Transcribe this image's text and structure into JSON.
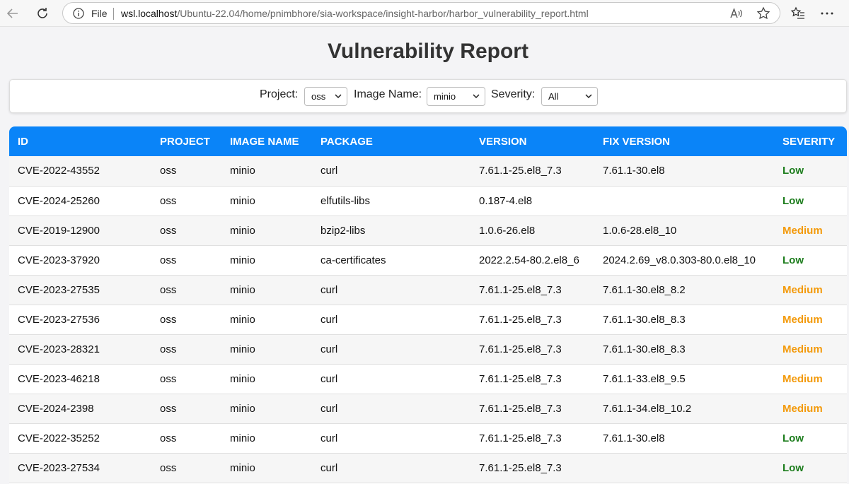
{
  "browser": {
    "file_label": "File",
    "url_host": "wsl.localhost",
    "url_path": "/Ubuntu-22.04/home/pnimbhore/sia-workspace/insight-harbor/harbor_vulnerability_report.html"
  },
  "page": {
    "title": "Vulnerability Report"
  },
  "filters": {
    "project_label": "Project:",
    "project_value": "oss",
    "image_label": "Image Name:",
    "image_value": "minio",
    "severity_label": "Severity:",
    "severity_value": "All"
  },
  "table": {
    "headers": [
      "ID",
      "PROJECT",
      "IMAGE NAME",
      "PACKAGE",
      "VERSION",
      "FIX VERSION",
      "SEVERITY"
    ],
    "rows": [
      [
        "CVE-2022-43552",
        "oss",
        "minio",
        "curl",
        "7.61.1-25.el8_7.3",
        "7.61.1-30.el8",
        "Low"
      ],
      [
        "CVE-2024-25260",
        "oss",
        "minio",
        "elfutils-libs",
        "0.187-4.el8",
        "",
        "Low"
      ],
      [
        "CVE-2019-12900",
        "oss",
        "minio",
        "bzip2-libs",
        "1.0.6-26.el8",
        "1.0.6-28.el8_10",
        "Medium"
      ],
      [
        "CVE-2023-37920",
        "oss",
        "minio",
        "ca-certificates",
        "2022.2.54-80.2.el8_6",
        "2024.2.69_v8.0.303-80.0.el8_10",
        "Low"
      ],
      [
        "CVE-2023-27535",
        "oss",
        "minio",
        "curl",
        "7.61.1-25.el8_7.3",
        "7.61.1-30.el8_8.2",
        "Medium"
      ],
      [
        "CVE-2023-27536",
        "oss",
        "minio",
        "curl",
        "7.61.1-25.el8_7.3",
        "7.61.1-30.el8_8.3",
        "Medium"
      ],
      [
        "CVE-2023-28321",
        "oss",
        "minio",
        "curl",
        "7.61.1-25.el8_7.3",
        "7.61.1-30.el8_8.3",
        "Medium"
      ],
      [
        "CVE-2023-46218",
        "oss",
        "minio",
        "curl",
        "7.61.1-25.el8_7.3",
        "7.61.1-33.el8_9.5",
        "Medium"
      ],
      [
        "CVE-2024-2398",
        "oss",
        "minio",
        "curl",
        "7.61.1-25.el8_7.3",
        "7.61.1-34.el8_10.2",
        "Medium"
      ],
      [
        "CVE-2022-35252",
        "oss",
        "minio",
        "curl",
        "7.61.1-25.el8_7.3",
        "7.61.1-30.el8",
        "Low"
      ],
      [
        "CVE-2023-27534",
        "oss",
        "minio",
        "curl",
        "7.61.1-25.el8_7.3",
        "",
        "Low"
      ]
    ]
  },
  "colors": {
    "header_bg": "#0a84f8",
    "low": "#1d7d1d",
    "medium": "#f39a0b"
  },
  "icons": [
    "back-arrow-icon",
    "refresh-icon",
    "info-icon",
    "read-aloud-icon",
    "favorite-star-icon",
    "favorites-bar-icon",
    "more-options-icon"
  ]
}
